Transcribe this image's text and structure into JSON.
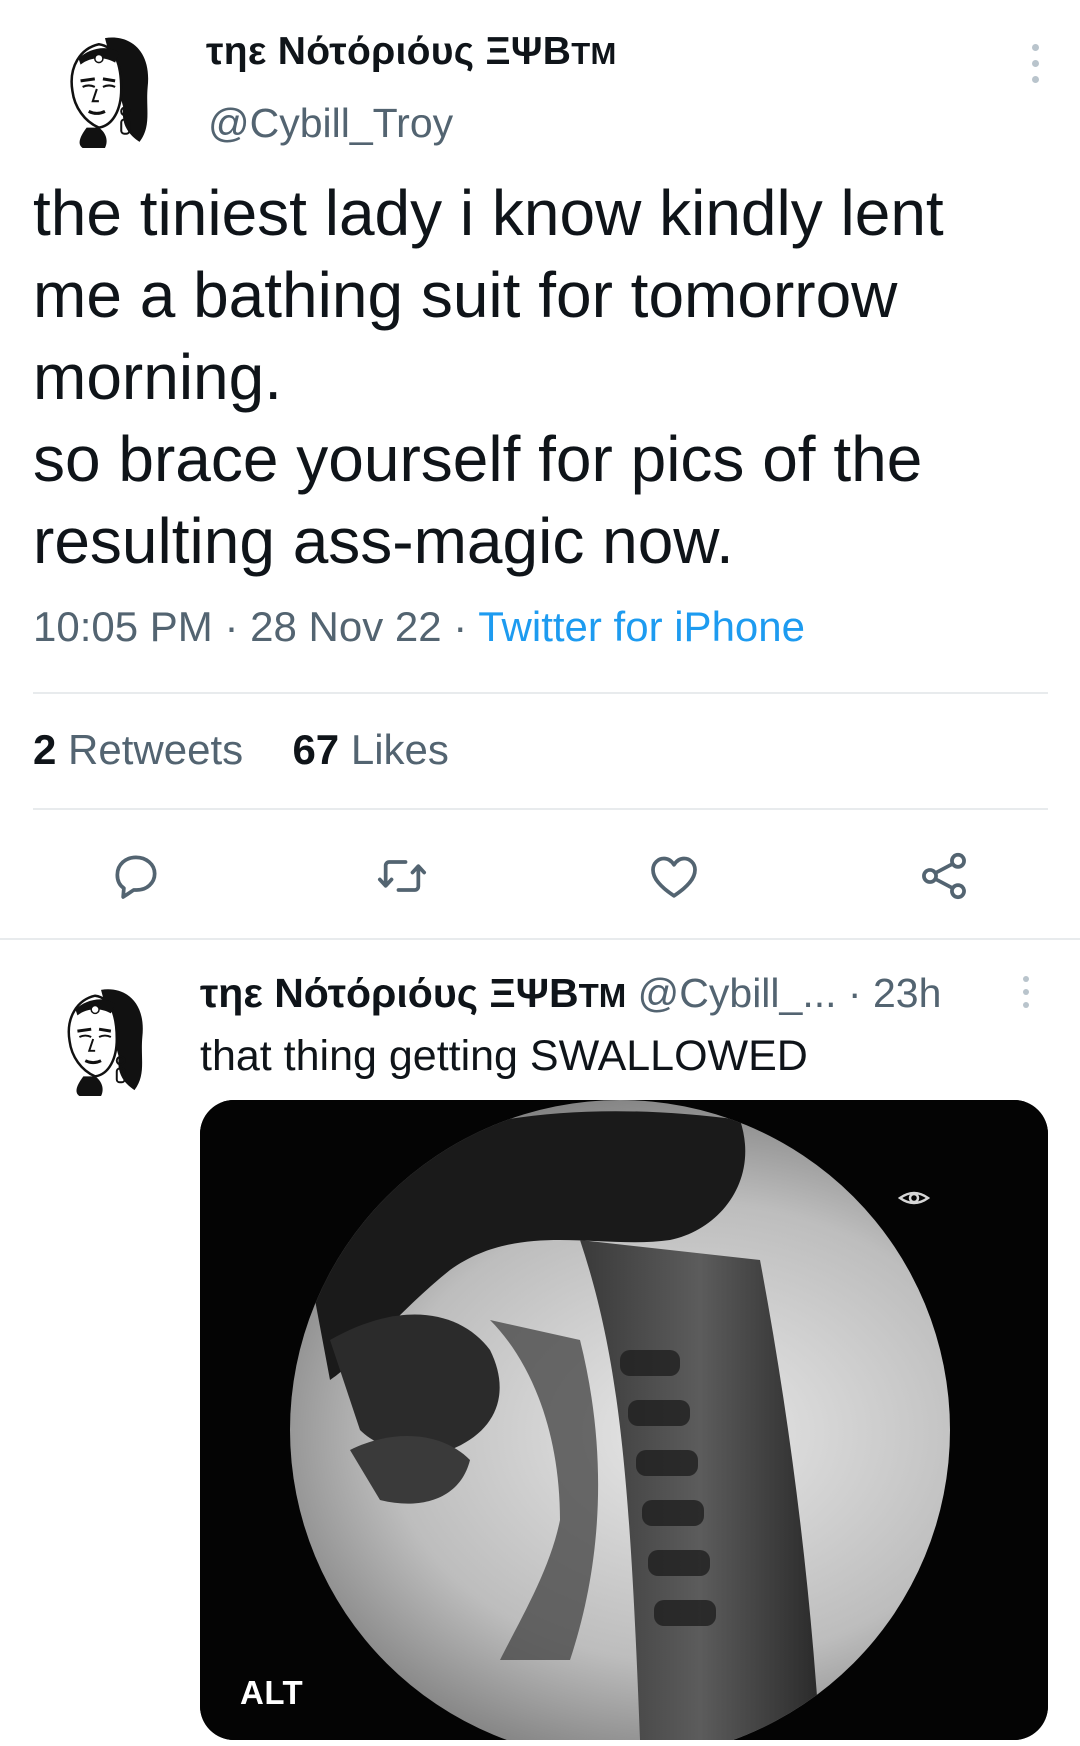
{
  "main_tweet": {
    "display_name": "τηε Νότόριόυς ΞΨΒ",
    "display_name_suffix": "TM",
    "handle": "@Cybill_Troy",
    "text": "the tiniest lady i know kindly lent\nme a bathing suit for tomorrow\nmorning.\nso brace yourself for pics of the\nresulting ass-magic now.",
    "time": "10:05 PM",
    "date": "28 Nov 22",
    "source": "Twitter for iPhone",
    "separator": "·",
    "retweets_count": "2",
    "retweets_label": "Retweets",
    "likes_count": "67",
    "likes_label": "Likes"
  },
  "actions": {
    "reply_icon": "reply-icon",
    "retweet_icon": "retweet-icon",
    "like_icon": "heart-icon",
    "share_icon": "share-icon"
  },
  "reply_tweet": {
    "display_name": "τηε Νότόριόυς ΞΨΒ",
    "display_name_suffix": "TM",
    "handle": "@Cybill_...",
    "separator": "·",
    "age": "23h",
    "text": "that thing getting SWALLOWED",
    "media_alt_badge": "ALT"
  },
  "colors": {
    "text_primary": "#0f1419",
    "text_secondary": "#536471",
    "link": "#1d9bf0",
    "divider": "#e8ebed"
  }
}
